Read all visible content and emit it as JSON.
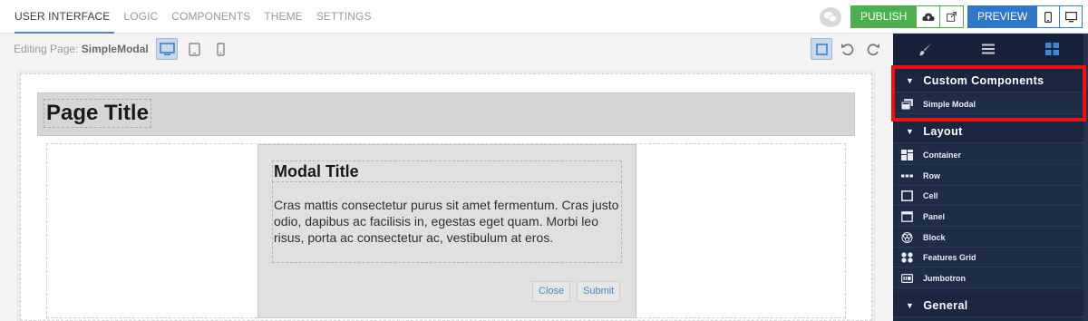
{
  "nav": {
    "tabs": [
      {
        "label": "USER INTERFACE",
        "active": true
      },
      {
        "label": "LOGIC"
      },
      {
        "label": "COMPONENTS"
      },
      {
        "label": "THEME"
      },
      {
        "label": "SETTINGS"
      }
    ]
  },
  "toolbar": {
    "publish_label": "PUBLISH",
    "preview_label": "PREVIEW",
    "publish_color": "#4cb050",
    "preview_color": "#2e78c7"
  },
  "editor": {
    "editing_prefix": "Editing Page:",
    "page_name": "SimpleModal",
    "active_device": "desktop"
  },
  "canvas": {
    "page_title": "Page Title",
    "modal": {
      "title": "Modal Title",
      "body": "Cras mattis consectetur purus sit amet fermentum. Cras justo odio, dapibus ac facilisis in, egestas eget quam. Morbi leo risus, porta ac consectetur ac, vestibulum at eros.",
      "close_label": "Close",
      "submit_label": "Submit"
    }
  },
  "sidebar": {
    "active_tab": "components-grid-icon",
    "sections": [
      {
        "label": "Custom Components",
        "items": [
          {
            "label": "Simple Modal",
            "icon": "modal-stack-icon"
          }
        ]
      },
      {
        "label": "Layout",
        "items": [
          {
            "label": "Container",
            "icon": "container-icon"
          },
          {
            "label": "Row",
            "icon": "row-icon"
          },
          {
            "label": "Cell",
            "icon": "cell-icon"
          },
          {
            "label": "Panel",
            "icon": "panel-icon"
          },
          {
            "label": "Block",
            "icon": "block-icon"
          },
          {
            "label": "Features Grid",
            "icon": "features-grid-icon"
          },
          {
            "label": "Jumbotron",
            "icon": "jumbotron-icon"
          }
        ]
      },
      {
        "label": "General",
        "items": []
      }
    ],
    "highlight_color": "#ee1111"
  }
}
